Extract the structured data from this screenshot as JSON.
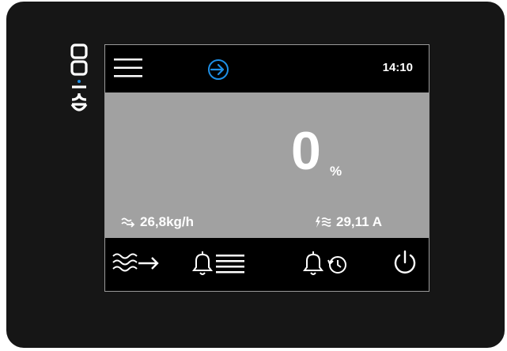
{
  "brand": {
    "logo_text": "EVCO"
  },
  "header": {
    "menu_icon": "hamburger-menu-icon",
    "login_icon": "login-arrow-icon",
    "login_color": "#1e8fe6",
    "time": "14:10"
  },
  "main": {
    "value": "0",
    "unit": "%",
    "flow": {
      "icon": "steam-flow-icon",
      "value": "26,8kg/h"
    },
    "current": {
      "icon": "electric-current-icon",
      "value": "29,11 A"
    },
    "background_color": "#a1a1a1"
  },
  "footer": {
    "buttons": [
      {
        "icon": "steam-output-icon"
      },
      {
        "icon": "alarm-list-icon"
      },
      {
        "icon": "alarm-history-icon"
      },
      {
        "icon": "power-icon"
      }
    ]
  }
}
